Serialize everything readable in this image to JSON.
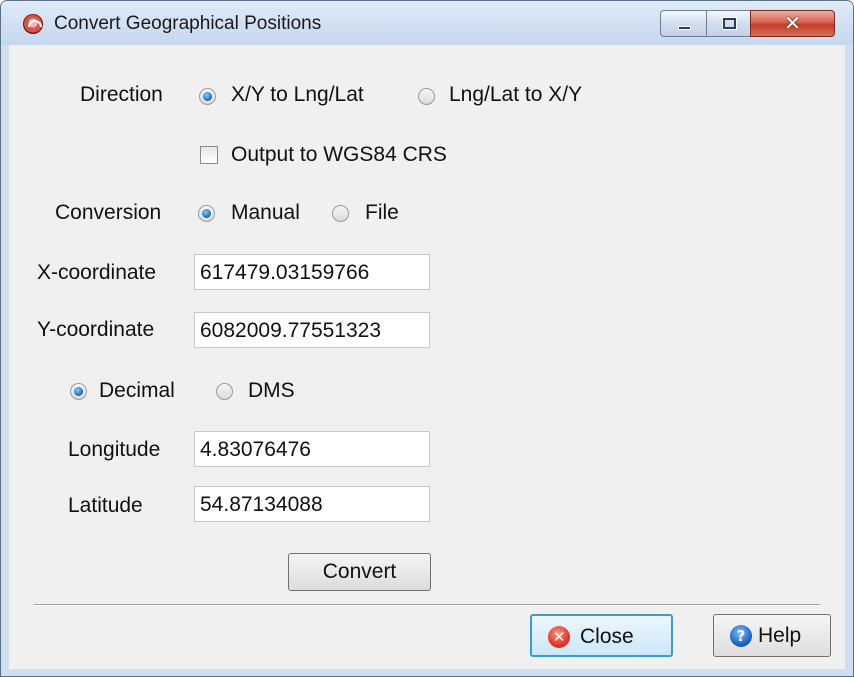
{
  "window": {
    "title": "Convert Geographical Positions",
    "close_glyph": "✕",
    "icons": [
      "app-icon",
      "minimize-icon",
      "maximize-icon",
      "close-icon"
    ]
  },
  "direction": {
    "label": "Direction",
    "options": [
      "X/Y to Lng/Lat",
      "Lng/Lat to X/Y"
    ],
    "selected": "X/Y to Lng/Lat"
  },
  "output_wgs84": {
    "label": "Output to WGS84 CRS",
    "checked": false
  },
  "conversion": {
    "label": "Conversion",
    "options": [
      "Manual",
      "File"
    ],
    "selected": "Manual"
  },
  "x_coordinate": {
    "label": "X-coordinate",
    "value": "617479.03159766"
  },
  "y_coordinate": {
    "label": "Y-coordinate",
    "value": "6082009.77551323"
  },
  "format": {
    "options": [
      "Decimal",
      "DMS"
    ],
    "selected": "Decimal"
  },
  "longitude": {
    "label": "Longitude",
    "value": "4.83076476"
  },
  "latitude": {
    "label": "Latitude",
    "value": "54.87134088"
  },
  "buttons": {
    "convert": "Convert",
    "close": "Close",
    "help": "Help",
    "close_icon_glyph": "✕",
    "help_icon_glyph": "?"
  },
  "colors": {
    "title_bar": "#c5d8ee",
    "dialog_bg": "#f0f0f0",
    "focus_accent": "#3c9ad8",
    "close_button_red": "#c13f2a"
  }
}
